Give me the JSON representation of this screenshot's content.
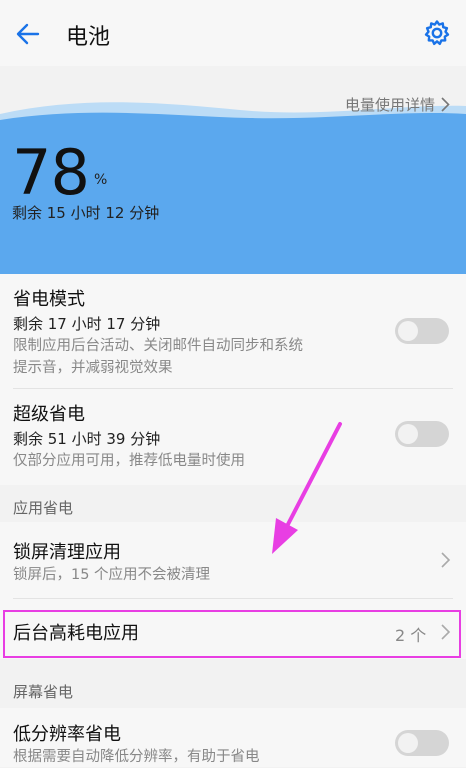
{
  "header": {
    "title": "电池",
    "back_icon": "arrow-left-icon",
    "settings_icon": "gear-icon"
  },
  "battery": {
    "details_label": "电量使用详情",
    "percent": "78",
    "percent_sign": "%",
    "remaining": "剩余 15 小时 12 分钟"
  },
  "power_saving": {
    "title": "省电模式",
    "remaining": "剩余 17 小时 17 分钟",
    "desc_line1": "限制应用后台活动、关闭邮件自动同步和系统",
    "desc_line2": "提示音，并减弱视觉效果",
    "enabled": false
  },
  "ultra_saving": {
    "title": "超级省电",
    "remaining": "剩余 51 小时 39 分钟",
    "desc": "仅部分应用可用，推荐低电量时使用",
    "enabled": false
  },
  "app_section": {
    "label": "应用省电",
    "lock_cleanup": {
      "title": "锁屏清理应用",
      "desc": "锁屏后，15 个应用不会被清理"
    },
    "background_apps": {
      "title": "后台高耗电应用",
      "count": "2 个"
    }
  },
  "screen_section": {
    "label": "屏幕省电",
    "low_res": {
      "title": "低分辨率省电",
      "desc": "根据需要自动降低分辨率，有助于省电",
      "enabled": false
    }
  },
  "colors": {
    "accent": "#1a73e8",
    "battery_fill": "#5ba8ee",
    "annotation": "#e83ee3"
  }
}
